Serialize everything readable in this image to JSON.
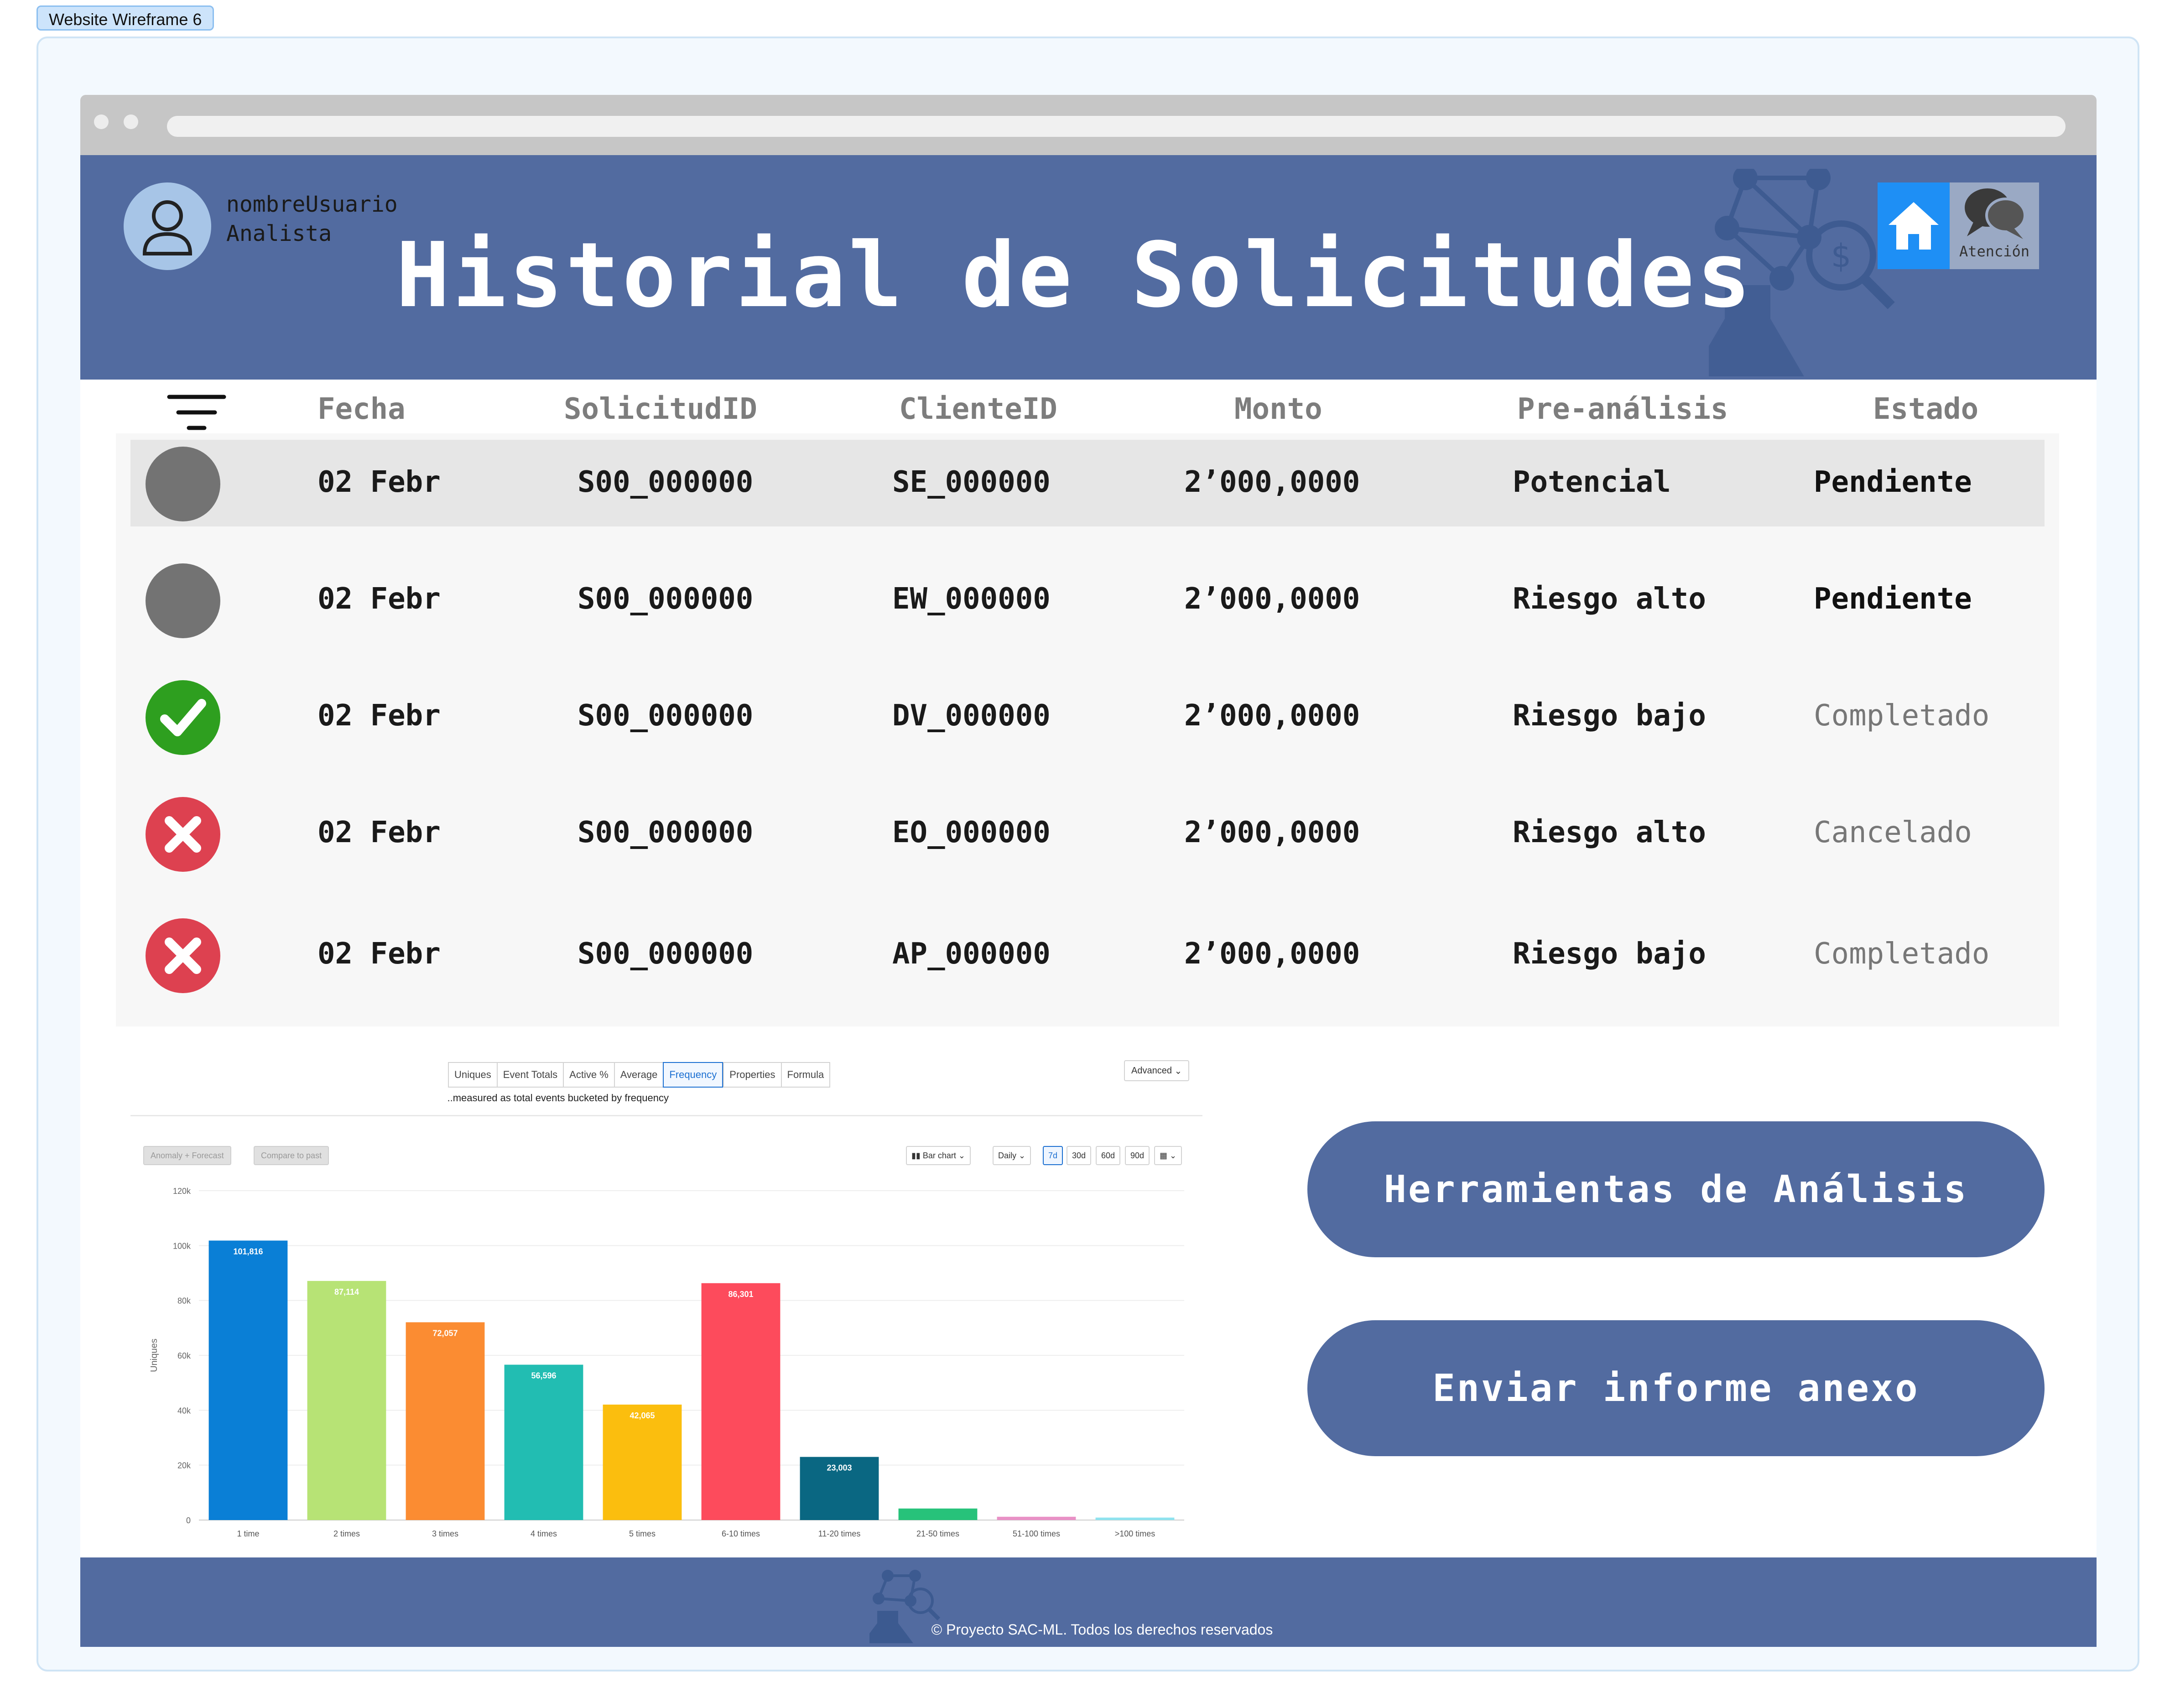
{
  "frame_tag": "Website Wireframe 6",
  "header": {
    "user_name": "nombreUsuario",
    "user_role": "Analista",
    "title": "Historial de Solicitudes",
    "chat_label": "Atención"
  },
  "table": {
    "columns": [
      "Fecha",
      "SolicitudID",
      "ClienteID",
      "Monto",
      "Pre-análisis",
      "Estado"
    ],
    "rows": [
      {
        "icon": "pending",
        "fecha": "02 Febr",
        "solicitud": "S00_000000",
        "cliente": "SE_000000",
        "monto": "2’000,0000",
        "pre": "Potencial",
        "estado": "Pendiente"
      },
      {
        "icon": "pending",
        "fecha": "02 Febr",
        "solicitud": "S00_000000",
        "cliente": "EW_000000",
        "monto": "2’000,0000",
        "pre": "Riesgo alto",
        "estado": "Pendiente"
      },
      {
        "icon": "check",
        "fecha": "02 Febr",
        "solicitud": "S00_000000",
        "cliente": "DV_000000",
        "monto": "2’000,0000",
        "pre": "Riesgo bajo",
        "estado": "Completado"
      },
      {
        "icon": "cross",
        "fecha": "02 Febr",
        "solicitud": "S00_000000",
        "cliente": "EO_000000",
        "monto": "2’000,0000",
        "pre": "Riesgo alto",
        "estado": "Cancelado"
      },
      {
        "icon": "cross",
        "fecha": "02 Febr",
        "solicitud": "S00_000000",
        "cliente": "AP_000000",
        "monto": "2’000,0000",
        "pre": "Riesgo bajo",
        "estado": "Completado"
      }
    ]
  },
  "analytics": {
    "tabs": [
      "Uniques",
      "Event Totals",
      "Active %",
      "Average",
      "Frequency",
      "Properties",
      "Formula"
    ],
    "active_tab": "Frequency",
    "advanced_label": "Advanced",
    "subtitle": "..measured as total events bucketed by frequency",
    "anomaly_label": "Anomaly + Forecast",
    "compare_label": "Compare to past",
    "chart_type_label": "Bar chart",
    "interval_label": "Daily",
    "ranges": [
      "7d",
      "30d",
      "60d",
      "90d"
    ],
    "active_range": "7d"
  },
  "chart_data": {
    "type": "bar",
    "ylabel": "Uniques",
    "ylim": [
      0,
      120000
    ],
    "yticks": [
      "0",
      "20k",
      "40k",
      "60k",
      "80k",
      "100k",
      "120k"
    ],
    "categories": [
      "1 time",
      "2 times",
      "3 times",
      "4 times",
      "5 times",
      "6-10 times",
      "11-20 times",
      "21-50 times",
      "51-100 times",
      ">100 times"
    ],
    "values": [
      101816,
      87114,
      72057,
      56596,
      42065,
      86301,
      23003,
      4200,
      1200,
      900
    ],
    "labels": [
      "101,816",
      "87,114",
      "72,057",
      "56,596",
      "42,065",
      "86,301",
      "23,003",
      "",
      "",
      ""
    ],
    "colors": [
      "#0a7fd6",
      "#b7e375",
      "#fb8c32",
      "#22bdb2",
      "#fbbe0e",
      "#fd4b5c",
      "#0a6782",
      "#27c27a",
      "#e991c6",
      "#8fe3ef"
    ]
  },
  "actions": {
    "tools": "Herramientas de Análisis",
    "report": "Enviar informe anexo"
  },
  "footer": {
    "text": "© Proyecto SAC-ML. Todos los derechos reservados"
  },
  "colors": {
    "brand_blue": "#526ba0",
    "check_green": "#2e9f1f",
    "cancel_red": "#dd4150",
    "pending_gray": "#737373",
    "home_blue": "#1e8ff5"
  }
}
